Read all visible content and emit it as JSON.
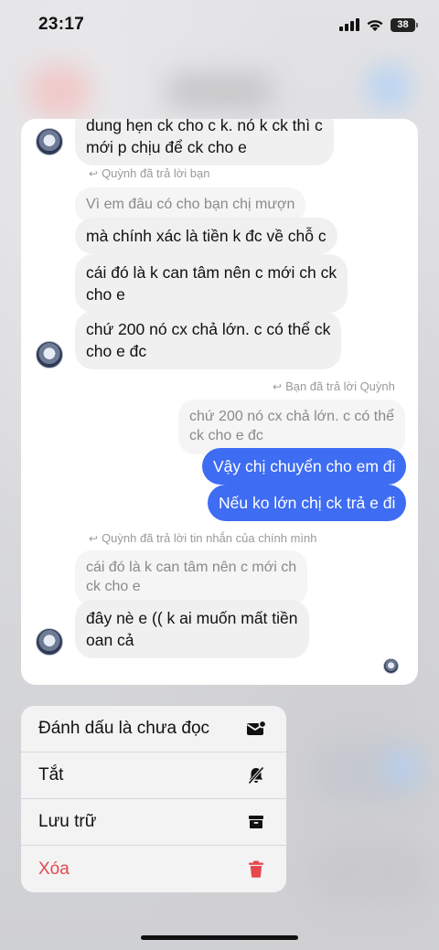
{
  "status_bar": {
    "time": "23:17",
    "battery": "38"
  },
  "chat": {
    "messages": [
      {
        "id": "m0",
        "text": "dung hẹn ck cho c k. nó k ck thì c\nmới p chịu để ck cho e"
      },
      {
        "id": "r1",
        "reply_label": "Quỳnh đã trả lời bạn"
      },
      {
        "id": "q1",
        "text": "Vì em đâu có cho bạn chị mượn"
      },
      {
        "id": "m1",
        "text": "mà chính xác là tiền k đc về chỗ c"
      },
      {
        "id": "m2",
        "text": "cái đó là k can tâm nên c mới ch ck\ncho e"
      },
      {
        "id": "m3",
        "text": "chứ 200 nó cx chả lớn. c có thể ck\ncho e đc"
      },
      {
        "id": "r2",
        "reply_label": "Bạn đã trả lời Quỳnh"
      },
      {
        "id": "q2",
        "text": "chứ 200 nó cx chả lớn. c có thể\nck cho e đc"
      },
      {
        "id": "o1",
        "text": "Vậy chị chuyển cho em đi"
      },
      {
        "id": "o2",
        "text": "Nếu ko lớn chị ck trả e đi"
      },
      {
        "id": "r3",
        "reply_label": "Quỳnh đã trả lời tin nhắn của chính mình"
      },
      {
        "id": "q3",
        "text": "cái đó là k can tâm nên c mới ch\nck cho e"
      },
      {
        "id": "m4",
        "text": "đây nè e (( k ai muốn mất tiền\noan cả"
      }
    ]
  },
  "context_menu": {
    "items": [
      {
        "label": "Đánh dấu là chưa đọc",
        "icon": "mark-unread-icon"
      },
      {
        "label": "Tắt",
        "icon": "bell-slash-icon"
      },
      {
        "label": "Lưu trữ",
        "icon": "archive-icon"
      },
      {
        "label": "Xóa",
        "icon": "trash-icon",
        "color": "#e5484d"
      }
    ]
  }
}
